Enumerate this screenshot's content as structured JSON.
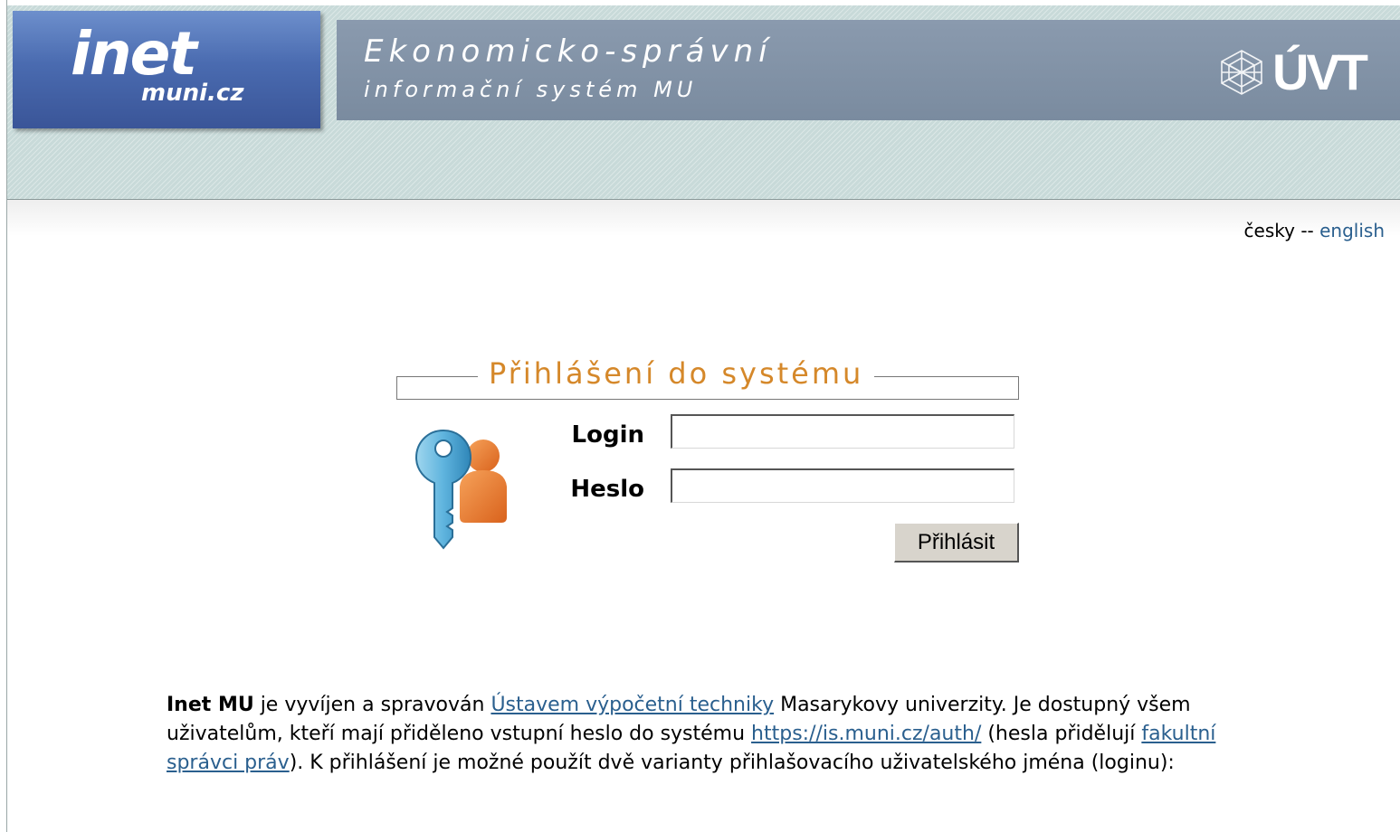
{
  "header": {
    "logo_main": "inet",
    "logo_sub": "muni.cz",
    "title_line1": "Ekonomicko-správní",
    "title_line2": "informační systém MU",
    "org_logo_text": "ÚVT",
    "org_logo_icon": "cube-wireframe-icon"
  },
  "language": {
    "current": "česky",
    "separator": "--",
    "other": "english"
  },
  "login": {
    "heading": "Přihlášení do systému",
    "icon": "key-user-icon",
    "login_label": "Login",
    "login_value": "",
    "password_label": "Heslo",
    "password_value": "",
    "submit_label": "Přihlásit"
  },
  "info": {
    "product_name": "Inet MU",
    "text1": " je vyvíjen a spravován ",
    "link_uvt": "Ústavem výpočetní techniky",
    "text2": " Masarykovy univerzity. Je dostupný všem uživatelům, kteří mají přiděleno vstupní heslo do systému ",
    "link_is": "https://is.muni.cz/auth/",
    "text3": " (hesla přidělují ",
    "link_admins": "fakultní správci práv",
    "text4": "). K přihlášení je možné použít dvě varianty přihlašovacího uživatelského jména (loginu):"
  },
  "colors": {
    "header_bg": "#c8dad9",
    "logo_blue": "#4a6bb0",
    "title_bar": "#8a9aae",
    "legend_orange": "#d5882a",
    "link_blue": "#2a5f8e"
  }
}
